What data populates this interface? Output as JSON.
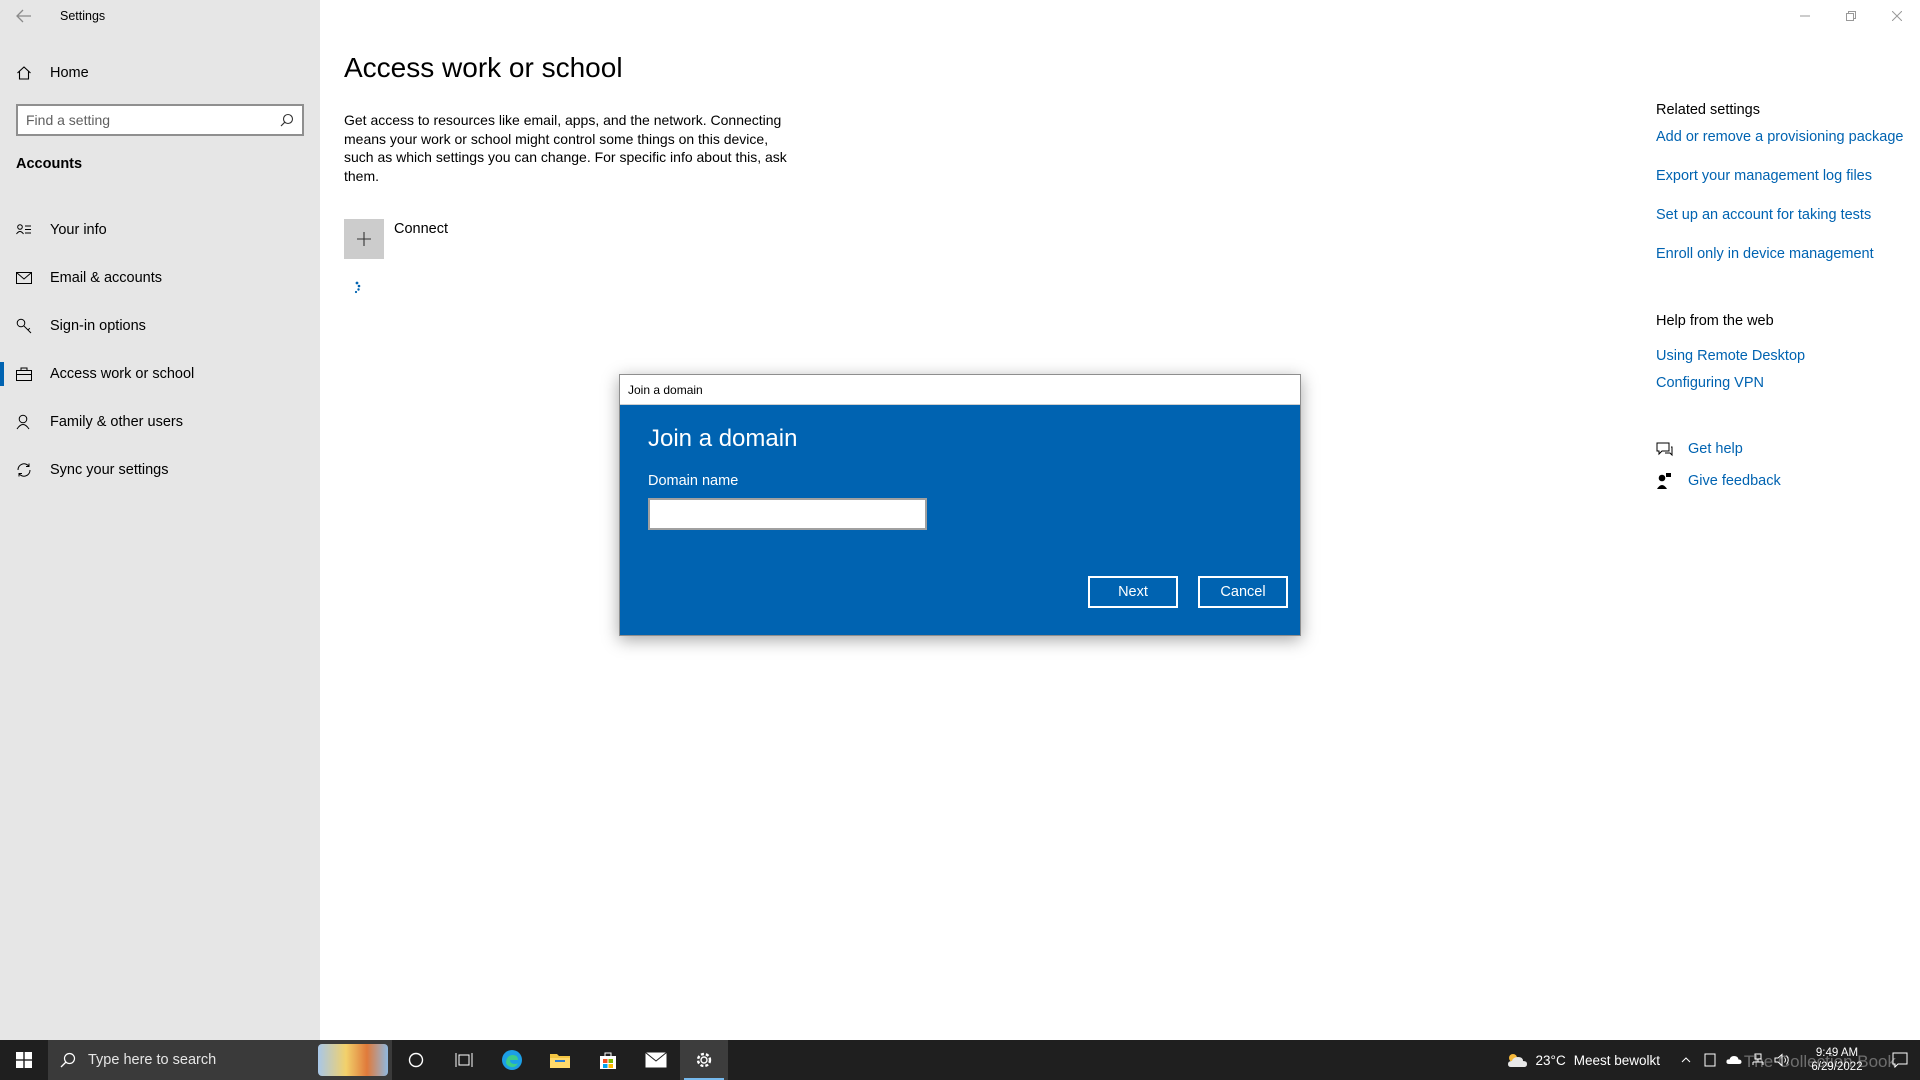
{
  "window": {
    "app_title": "Settings",
    "back_icon": "back-arrow-icon",
    "controls": [
      "minimize-icon",
      "restore-icon",
      "close-icon"
    ]
  },
  "sidebar": {
    "home_label": "Home",
    "search_placeholder": "Find a setting",
    "section_title": "Accounts",
    "items": [
      {
        "label": "Your info",
        "icon": "person-card-icon"
      },
      {
        "label": "Email & accounts",
        "icon": "mail-icon"
      },
      {
        "label": "Sign-in options",
        "icon": "key-icon"
      },
      {
        "label": "Access work or school",
        "icon": "briefcase-icon",
        "active": true
      },
      {
        "label": "Family & other users",
        "icon": "person-add-icon"
      },
      {
        "label": "Sync your settings",
        "icon": "sync-icon"
      }
    ]
  },
  "main": {
    "title": "Access work or school",
    "description": "Get access to resources like email, apps, and the network. Connecting means your work or school might control some things on this device, such as which settings you can change. For specific info about this, ask them.",
    "connect_label": "Connect"
  },
  "related": {
    "heading": "Related settings",
    "links": [
      "Add or remove a provisioning package",
      "Export your management log files",
      "Set up an account for taking tests",
      "Enroll only in device management"
    ],
    "help_heading": "Help from the web",
    "help_links": [
      "Using Remote Desktop",
      "Configuring VPN"
    ],
    "get_help": "Get help",
    "give_feedback": "Give feedback"
  },
  "dialog": {
    "titlebar": "Join a domain",
    "heading": "Join a domain",
    "field_label": "Domain name",
    "field_value": "",
    "next_label": "Next",
    "cancel_label": "Cancel"
  },
  "taskbar": {
    "search_placeholder": "Type here to search",
    "weather_temp": "23°C",
    "weather_desc": "Meest bewolkt",
    "time": "9:49 AM",
    "date": "6/29/2022",
    "watermark": "The Collection Book"
  },
  "colors": {
    "accent": "#0063b1",
    "sidebar_bg": "#e6e6e6",
    "taskbar_bg": "#1f1f1f"
  }
}
